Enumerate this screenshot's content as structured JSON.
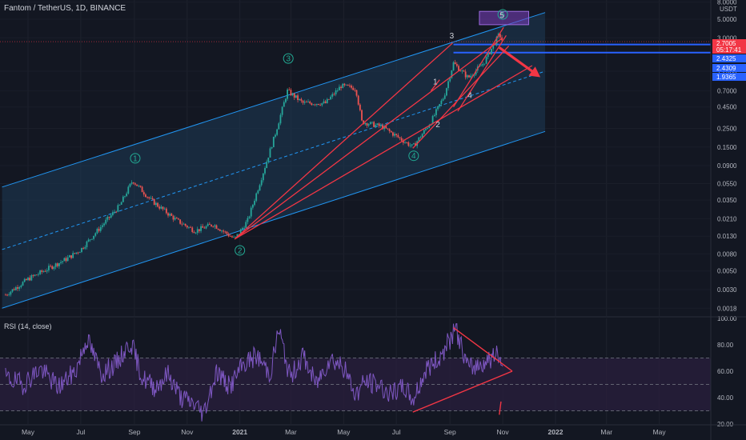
{
  "header": {
    "symbol_title": "Fantom / TetherUS, 1D, BINANCE"
  },
  "rsi_header": {
    "label": "RSI (14, close)"
  },
  "colors": {
    "background": "#131722",
    "channel": "#2196f3",
    "channel_fill": "#1e3a56",
    "trend": "#f23645",
    "candle_up": "#26a69a",
    "candle_down": "#ef5350",
    "rsi_line": "#7e57c2",
    "rsi_band": "#2a1f3d",
    "target_box": "#7b3fc0",
    "wave_labels": "#22ab94"
  },
  "chart_data": [
    {
      "type": "candlestick",
      "title": "Fantom / TetherUS, 1D, BINANCE",
      "yscale": "log",
      "ylim": [
        0.0013,
        8.0
      ],
      "y_unit": "USDT",
      "y_ticks": [
        "8.0000",
        "5.0000",
        "3.0000",
        "1.2000",
        "0.7000",
        "0.4500",
        "0.2500",
        "0.1500",
        "0.0900",
        "0.0550",
        "0.0350",
        "0.0210",
        "0.0130",
        "0.0080",
        "0.0050",
        "0.0030",
        "0.0018"
      ],
      "y_tick_values": [
        8.0,
        5.0,
        3.0,
        1.2,
        0.7,
        0.45,
        0.25,
        0.15,
        0.09,
        0.055,
        0.035,
        0.021,
        0.013,
        0.008,
        0.005,
        0.003,
        0.0018
      ],
      "x_ticks": [
        "May",
        "Jul",
        "Sep",
        "Nov",
        "2021",
        "Mar",
        "May",
        "Jul",
        "Sep",
        "Nov",
        "2022",
        "Mar",
        "May"
      ],
      "x_tick_dates": [
        "2020-05-01",
        "2020-07-01",
        "2020-09-01",
        "2020-11-01",
        "2021-01-01",
        "2021-03-01",
        "2021-05-01",
        "2021-07-01",
        "2021-09-01",
        "2021-11-01",
        "2022-01-01",
        "2022-03-01",
        "2022-05-01"
      ],
      "price_path": [
        [
          "2020-04-05",
          0.0026
        ],
        [
          "2020-05-01",
          0.004
        ],
        [
          "2020-06-15",
          0.007
        ],
        [
          "2020-07-01",
          0.009
        ],
        [
          "2020-07-20",
          0.015
        ],
        [
          "2020-08-15",
          0.03
        ],
        [
          "2020-08-30",
          0.06
        ],
        [
          "2020-09-20",
          0.035
        ],
        [
          "2020-10-20",
          0.02
        ],
        [
          "2020-11-10",
          0.015
        ],
        [
          "2020-12-01",
          0.018
        ],
        [
          "2020-12-26",
          0.012
        ],
        [
          "2021-01-10",
          0.02
        ],
        [
          "2021-01-25",
          0.06
        ],
        [
          "2021-02-10",
          0.2
        ],
        [
          "2021-02-25",
          0.7
        ],
        [
          "2021-03-15",
          0.5
        ],
        [
          "2021-04-10",
          0.5
        ],
        [
          "2021-04-28",
          0.8
        ],
        [
          "2021-05-15",
          0.75
        ],
        [
          "2021-05-22",
          0.3
        ],
        [
          "2021-06-15",
          0.26
        ],
        [
          "2021-07-20",
          0.15
        ],
        [
          "2021-08-10",
          0.3
        ],
        [
          "2021-08-25",
          0.6
        ],
        [
          "2021-09-05",
          1.5
        ],
        [
          "2021-09-22",
          1.0
        ],
        [
          "2021-10-10",
          1.5
        ],
        [
          "2021-10-28",
          3.3
        ],
        [
          "2021-11-01",
          2.7005
        ]
      ],
      "price_labels": [
        {
          "text": "2.7005",
          "value": 2.7005,
          "color": "#f23645"
        },
        {
          "text": "05:17:41",
          "value": 2.7005,
          "color": "#f23645",
          "role": "countdown"
        },
        {
          "text": "2.4325",
          "value": 2.4325,
          "color": "#2962ff"
        },
        {
          "text": "2.4309",
          "value": 2.4309,
          "color": "#2962ff"
        },
        {
          "text": "1.9365",
          "value": 1.9365,
          "color": "#2962ff"
        }
      ],
      "horizontal_levels": [
        2.5,
        2.0
      ],
      "channel": {
        "upper": [
          [
            "2020-04-01",
            0.05
          ],
          [
            "2021-12-20",
            6.0
          ]
        ],
        "middle": [
          [
            "2020-04-01",
            0.009
          ],
          [
            "2021-12-20",
            1.2
          ]
        ],
        "lower": [
          [
            "2020-04-01",
            0.0018
          ],
          [
            "2021-12-20",
            0.23
          ]
        ]
      },
      "target_zone": {
        "x": [
          "2021-10-05",
          "2021-12-01"
        ],
        "y": [
          4.3,
          6.2
        ]
      },
      "projection_arrow": [
        [
          "2021-10-28",
          2.3
        ],
        [
          "2021-12-10",
          1.1
        ]
      ],
      "wave_labels": [
        {
          "text": "1",
          "date": "2020-09-02",
          "value": 0.11,
          "circled": true
        },
        {
          "text": "2",
          "date": "2021-01-01",
          "value": 0.0088,
          "circled": true
        },
        {
          "text": "3",
          "date": "2021-02-26",
          "value": 1.7,
          "circled": true
        },
        {
          "text": "4",
          "date": "2021-07-21",
          "value": 0.118,
          "circled": true
        },
        {
          "text": "5",
          "date": "2021-11-01",
          "value": 5.7,
          "circled": true
        },
        {
          "text": "1",
          "date": "2021-08-15",
          "value": 0.9,
          "circled": false
        },
        {
          "text": "2",
          "date": "2021-08-18",
          "value": 0.28,
          "circled": false
        },
        {
          "text": "3",
          "date": "2021-09-03",
          "value": 3.2,
          "circled": false
        },
        {
          "text": "4",
          "date": "2021-09-24",
          "value": 0.62,
          "circled": false
        },
        {
          "text": "5",
          "date": "2021-10-31",
          "value": 5.6,
          "circled": false
        }
      ]
    },
    {
      "type": "line",
      "title": "RSI (14, close)",
      "ylim": [
        20,
        100
      ],
      "y_ticks": [
        "100.00",
        "80.00",
        "60.00",
        "40.00",
        "20.00"
      ],
      "y_tick_values": [
        100,
        80,
        60,
        40,
        20
      ],
      "band": [
        30,
        70
      ],
      "midline": 50,
      "series": [
        {
          "values": [
            [
              "2020-04-05",
              55
            ],
            [
              "2020-04-25",
              50
            ],
            [
              "2020-05-15",
              62
            ],
            [
              "2020-06-05",
              48
            ],
            [
              "2020-06-25",
              60
            ],
            [
              "2020-07-08",
              85
            ],
            [
              "2020-07-25",
              58
            ],
            [
              "2020-08-10",
              65
            ],
            [
              "2020-08-28",
              82
            ],
            [
              "2020-09-10",
              55
            ],
            [
              "2020-09-25",
              48
            ],
            [
              "2020-10-10",
              58
            ],
            [
              "2020-10-25",
              40
            ],
            [
              "2020-11-10",
              35
            ],
            [
              "2020-11-20",
              28
            ],
            [
              "2020-12-05",
              60
            ],
            [
              "2020-12-20",
              48
            ],
            [
              "2021-01-05",
              65
            ],
            [
              "2021-01-20",
              72
            ],
            [
              "2021-02-05",
              58
            ],
            [
              "2021-02-15",
              92
            ],
            [
              "2021-02-28",
              55
            ],
            [
              "2021-03-15",
              72
            ],
            [
              "2021-03-30",
              50
            ],
            [
              "2021-04-15",
              70
            ],
            [
              "2021-04-30",
              64
            ],
            [
              "2021-05-15",
              42
            ],
            [
              "2021-05-25",
              52
            ],
            [
              "2021-06-10",
              50
            ],
            [
              "2021-06-25",
              42
            ],
            [
              "2021-07-10",
              48
            ],
            [
              "2021-07-20",
              38
            ],
            [
              "2021-08-05",
              62
            ],
            [
              "2021-08-20",
              70
            ],
            [
              "2021-08-30",
              82
            ],
            [
              "2021-09-08",
              92
            ],
            [
              "2021-09-22",
              62
            ],
            [
              "2021-10-05",
              65
            ],
            [
              "2021-10-18",
              70
            ],
            [
              "2021-10-28",
              72
            ],
            [
              "2021-11-01",
              62
            ]
          ]
        }
      ]
    }
  ]
}
